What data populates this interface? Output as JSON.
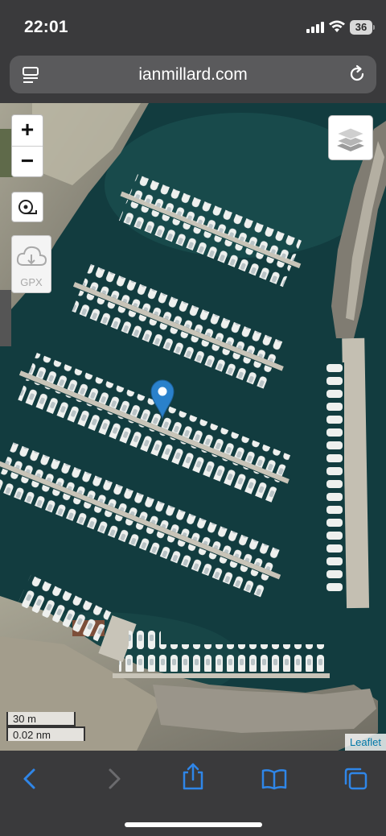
{
  "status_bar": {
    "time": "22:01",
    "battery": "36",
    "icons": [
      "cellular-signal-icon",
      "wifi-icon",
      "battery-icon"
    ]
  },
  "address_bar": {
    "url": "ianmillard.com",
    "left_icon": "reader-mode-icon",
    "right_icon": "reload-icon"
  },
  "map": {
    "controls": {
      "zoom_in": "+",
      "zoom_out": "−",
      "measure_icon": "tape-measure-icon",
      "gpx_label": "GPX",
      "gpx_icon": "cloud-download-icon",
      "layers_icon": "layers-icon"
    },
    "marker_icon": "location-pin-icon",
    "scale": {
      "metric": "30 m",
      "nautical": "0.02 nm"
    },
    "attribution": "Leaflet",
    "colors": {
      "water": "#123c3f",
      "marker": "#2a81cb",
      "pier": "#c8c4b8",
      "land": "#8d8a80"
    }
  },
  "toolbar": {
    "buttons": [
      "back-icon",
      "forward-icon",
      "share-icon",
      "bookmarks-icon",
      "tabs-icon"
    ],
    "accent": "#2f86e8"
  }
}
